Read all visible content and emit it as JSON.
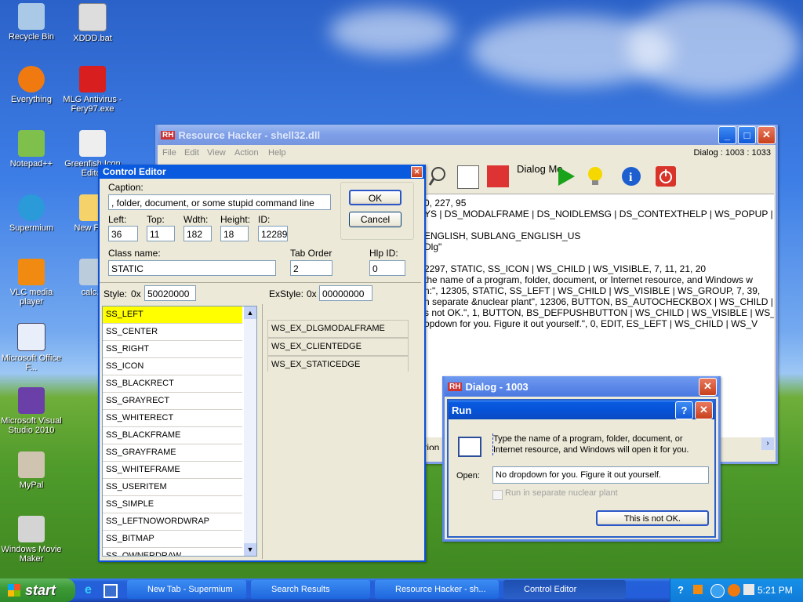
{
  "desktop": {
    "icons": [
      {
        "label": "Recycle Bin",
        "icon": "recycle-bin-icon"
      },
      {
        "label": "XDDD.bat",
        "icon": "batch-file-icon"
      },
      {
        "label": "Everything",
        "icon": "everything-icon"
      },
      {
        "label": "MLG Antivirus - Fery97.exe",
        "icon": "antivirus-icon"
      },
      {
        "label": "Notepad++",
        "icon": "notepad-icon"
      },
      {
        "label": "Greenfish Icon Editor",
        "icon": "greenfish-icon"
      },
      {
        "label": "Supermium",
        "icon": "browser-icon"
      },
      {
        "label": "New Fo...",
        "icon": "folder-icon"
      },
      {
        "label": "VLC media player",
        "icon": "vlc-icon"
      },
      {
        "label": "calc...",
        "icon": "calculator-icon"
      },
      {
        "label": "Microsoft Office F...",
        "icon": "office-icon"
      },
      {
        "label": "Microsoft Visual Studio 2010",
        "icon": "visual-studio-icon"
      },
      {
        "label": "MyPal",
        "icon": "mypal-icon"
      },
      {
        "label": "Windows Movie Maker",
        "icon": "movie-maker-icon"
      }
    ]
  },
  "rh": {
    "title": "Resource Hacker - shell32.dll",
    "menu": [
      "File",
      "Edit",
      "View",
      "Action",
      "Help"
    ],
    "status": "Dialog : 1003 : 1033",
    "toolbar_dialog_label": "Dialog Me",
    "code": [
      "0, 227, 95",
      "YS | DS_MODALFRAME | DS_NOIDLEMSG | DS_CONTEXTHELP | WS_POPUP | WS",
      "ENGLISH, SUBLANG_ENGLISH_US",
      "Dlg\"",
      "2297, STATIC, SS_ICON | WS_CHILD | WS_VISIBLE, 7, 11, 21, 20",
      "the name of a program, folder, document, or Internet resource, and Windows w",
      "n:\", 12305, STATIC, SS_LEFT | WS_CHILD | WS_VISIBLE | WS_GROUP, 7, 39,",
      "n separate &nuclear plant\", 12306, BUTTON, BS_AUTOCHECKBOX | WS_CHILD |",
      "s not OK.\", 1, BUTTON, BS_DEFPUSHBUTTON | WS_CHILD | WS_VISIBLE | WS_",
      "opdown for you. Figure it out yourself.\", 0, EDIT, ES_LEFT | WS_CHILD | WS_V"
    ],
    "partial_tab": "tion"
  },
  "ce": {
    "title": "Control Editor",
    "caption_label": "Caption:",
    "caption_value": ", folder, document, or some stupid command line",
    "left_label": "Left:",
    "left_value": "36",
    "top_label": "Top:",
    "top_value": "11",
    "width_label": "Wdth:",
    "width_value": "182",
    "height_label": "Height:",
    "height_value": "18",
    "id_label": "ID:",
    "id_value": "12289",
    "classname_label": "Class name:",
    "classname_value": "STATIC",
    "taborder_label": "Tab Order",
    "taborder_value": "2",
    "hlpid_label": "Hlp ID:",
    "hlpid_value": "0",
    "ok": "OK",
    "cancel": "Cancel",
    "style_label": "Style:",
    "style_prefix": "0x",
    "style_value": "50020000",
    "exstyle_label": "ExStyle:",
    "exstyle_prefix": "0x",
    "exstyle_value": "00000000",
    "styles": [
      "SS_LEFT",
      "SS_CENTER",
      "SS_RIGHT",
      "SS_ICON",
      "SS_BLACKRECT",
      "SS_GRAYRECT",
      "SS_WHITERECT",
      "SS_BLACKFRAME",
      "SS_GRAYFRAME",
      "SS_WHITEFRAME",
      "SS_USERITEM",
      "SS_SIMPLE",
      "SS_LEFTNOWORDWRAP",
      "SS_BITMAP",
      "SS_OWNERDRAW"
    ],
    "exstyles": [
      "WS_EX_DLGMODALFRAME",
      "WS_EX_CLIENTEDGE",
      "WS_EX_STATICEDGE"
    ]
  },
  "dlg": {
    "title": "Dialog -  1003",
    "inner_title": "Run",
    "text": "Type the name of a program, folder, document, or Internet resource, and Windows will open it for you.",
    "open_label": "Open:",
    "open_value": "No dropdown for you. Figure it out yourself.",
    "checkbox_label": "Run in separate nuclear plant",
    "button": "This is not OK."
  },
  "taskbar": {
    "start": "start",
    "buttons": [
      "New Tab - Supermium",
      "Search Results",
      "Resource Hacker - sh...",
      "Control Editor"
    ],
    "time": "5:21 PM"
  }
}
